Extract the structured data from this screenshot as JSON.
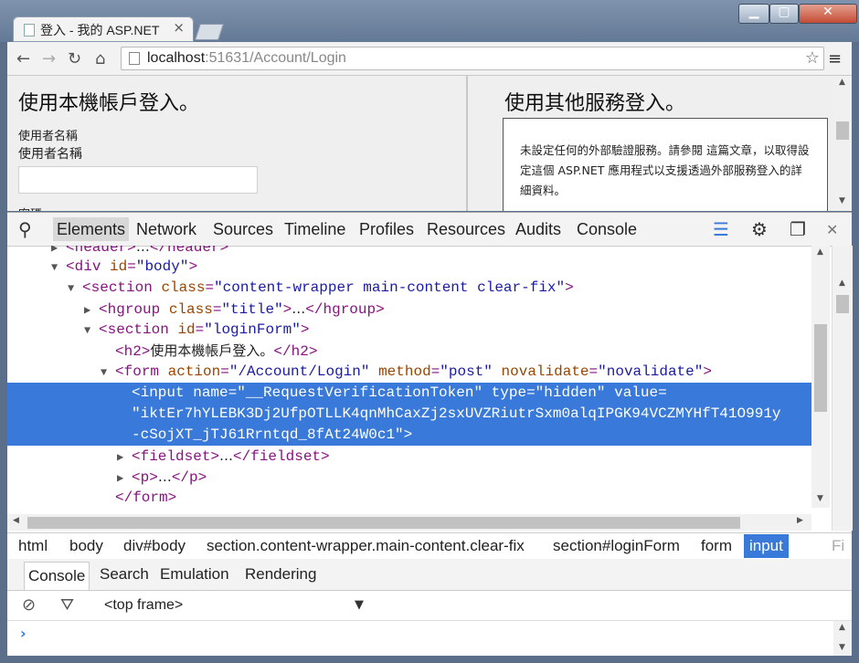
{
  "browser": {
    "tab_title": "登入 - 我的 ASP.NET",
    "tab_close": "×",
    "url_host": "localhost",
    "url_rest": ":51631/Account/Login"
  },
  "page": {
    "left_heading": "使用本機帳戶登入。",
    "username_label_small": "使用者名稱",
    "username_label": "使用者名稱",
    "password_label_partial": "密碼",
    "right_heading": "使用其他服務登入。",
    "info_text": "未設定任何的外部驗證服務。請參閱 這篇文章，以取得設定這個 ASP.NET 應用程式以支援透過外部服務登入的詳細資料。"
  },
  "devtools": {
    "tabs": [
      "Elements",
      "Network",
      "Sources",
      "Timeline",
      "Profiles",
      "Resources",
      "Audits",
      "Console"
    ],
    "active_tab": "Elements",
    "dom": {
      "header": {
        "open": "<header>",
        "ellipsis": "…",
        "close": "</header>"
      },
      "div_body": {
        "tag": "div",
        "attr": "id",
        "value": "\"body\""
      },
      "section_main": {
        "tag": "section",
        "attr": "class",
        "value": "\"content-wrapper main-content clear-fix\""
      },
      "hgroup": {
        "tag": "hgroup",
        "attr": "class",
        "value": "\"title\"",
        "ellipsis": "…",
        "close": "</hgroup>"
      },
      "section_login": {
        "tag": "section",
        "attr": "id",
        "value": "\"loginForm\""
      },
      "h2": {
        "open": "<h2>",
        "text": "使用本機帳戶登入。",
        "close": "</h2>"
      },
      "form": {
        "tag": "form",
        "attr1": "action",
        "value1": "\"/Account/Login\"",
        "attr2": "method",
        "value2": "\"post\"",
        "attr3": "novalidate",
        "value3": "\"novalidate\""
      },
      "input": {
        "line1_start": "<input name=",
        "name_value": "\"__RequestVerificationToken\"",
        "type_attr": " type=",
        "type_value": "\"hidden\"",
        "value_attr": " value=",
        "line2": "\"iktEr7hYLEBK3Dj2UfpOTLLK4qnMhCaxZj2sxUVZRiutrSxm0alqIPGK94VCZMYHfT41O991y",
        "line3": "-cSojXT_jTJ61Rrntqd_8fAt24W0c1\">"
      },
      "fieldset": {
        "open": "<fieldset>",
        "ellipsis": "…",
        "close": "</fieldset>"
      },
      "p": {
        "open": "<p>",
        "ellipsis": "…",
        "close": "</p>"
      },
      "form_close": "</form>"
    },
    "breadcrumbs": [
      "html",
      "body",
      "div#body",
      "section.content-wrapper.main-content.clear-fix",
      "section#loginForm",
      "form",
      "input",
      "Fi"
    ],
    "active_crumb": "input",
    "drawer_tabs": [
      "Console",
      "Search",
      "Emulation",
      "Rendering"
    ],
    "active_drawer_tab": "Console",
    "frame_select": "<top frame>",
    "prompt": "›"
  }
}
